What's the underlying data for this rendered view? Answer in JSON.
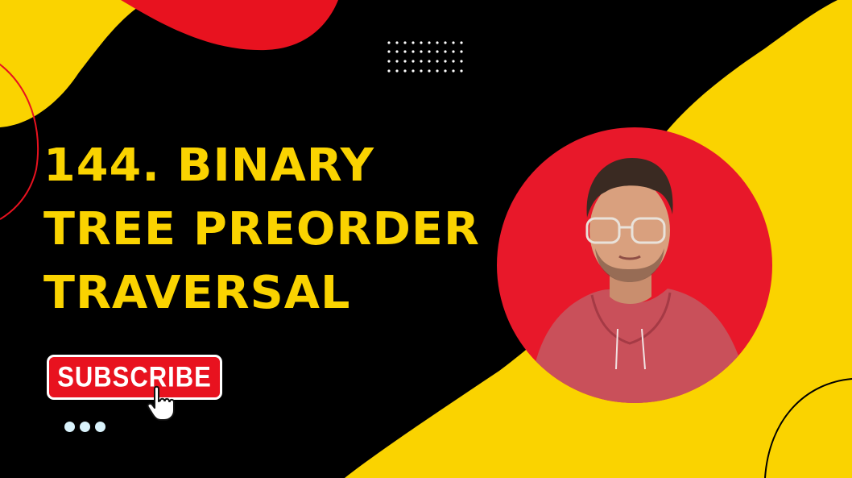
{
  "thumbnail": {
    "title_lines": [
      "144. BINARY",
      "TREE PREORDER",
      "TRAVERSAL"
    ],
    "subscribe_label": "SUBSCRIBE"
  },
  "colors": {
    "background": "#000000",
    "yellow": "#FAD300",
    "red": "#E8121F",
    "dot": "#D9F2FB"
  },
  "icons": {
    "pointer": "hand-pointer-icon",
    "menu": "more-dots-icon"
  }
}
